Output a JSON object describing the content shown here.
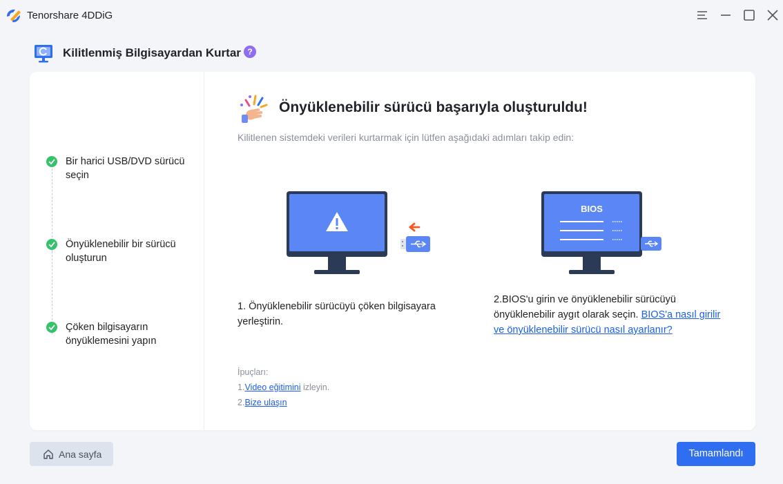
{
  "app": {
    "title": "Tenorshare 4DDiG"
  },
  "header": {
    "title": "Kilitlenmiş Bilgisayardan Kurtar",
    "help": "?"
  },
  "steps": [
    {
      "label": "Bir harici USB/DVD sürücü seçin",
      "done": true
    },
    {
      "label": "Önyüklenebilir bir sürücü oluşturun",
      "done": true
    },
    {
      "label": "Çöken bilgisayarın önyüklemesini yapın",
      "done": true
    }
  ],
  "main": {
    "title": "Önyüklenebilir sürücü başarıyla oluşturuldu!",
    "instruction": "Kilitlenen sistemdeki verileri kurtarmak için lütfen aşağıdaki adımları takip edin:",
    "step1": "1. Önyüklenebilir sürücüyü çöken bilgisayara yerleştirin.",
    "step2_text": "2.BIOS'u girin ve önyüklenebilir sürücüyü önyüklenebilir aygıt olarak seçin. ",
    "step2_link": "BIOS'a nasıl girilir ve önyüklenebilir sürücü nasıl ayarlanır?",
    "bios_label": "BIOS",
    "tips": {
      "title": "İpuçları:",
      "tip1_prefix": "1.",
      "tip1_link": "Video eğitimini",
      "tip1_suffix": " izleyin.",
      "tip2_prefix": "2.",
      "tip2_link": "Bize ulaşın"
    }
  },
  "footer": {
    "home_label": "Ana sayfa",
    "done_label": "Tamamlandı"
  },
  "colors": {
    "accent": "#2f6ef0",
    "check": "#35c26b",
    "monitor": "#5b86f5",
    "link": "#1c5ee8",
    "help": "#8f6cf2"
  }
}
